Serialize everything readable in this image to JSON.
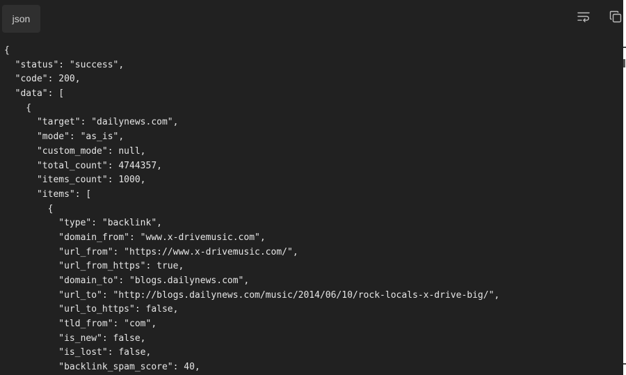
{
  "header": {
    "language": "json"
  },
  "toolbar": {
    "wrap_icon": "text-wrap-icon",
    "copy_icon": "copy-icon"
  },
  "code_lines": [
    "{",
    "  \"status\": \"success\",",
    "  \"code\": 200,",
    "  \"data\": [",
    "    {",
    "      \"target\": \"dailynews.com\",",
    "      \"mode\": \"as_is\",",
    "      \"custom_mode\": null,",
    "      \"total_count\": 4744357,",
    "      \"items_count\": 1000,",
    "      \"items\": [",
    "        {",
    "          \"type\": \"backlink\",",
    "          \"domain_from\": \"www.x-drivemusic.com\",",
    "          \"url_from\": \"https://www.x-drivemusic.com/\",",
    "          \"url_from_https\": true,",
    "          \"domain_to\": \"blogs.dailynews.com\",",
    "          \"url_to\": \"http://blogs.dailynews.com/music/2014/06/10/rock-locals-x-drive-big/\",",
    "          \"url_to_https\": false,",
    "          \"tld_from\": \"com\",",
    "          \"is_new\": false,",
    "          \"is_lost\": false,",
    "          \"backlink_spam_score\": 40,"
  ]
}
